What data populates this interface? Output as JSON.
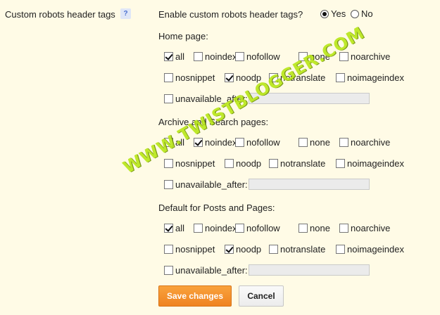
{
  "field_label": "Custom robots header tags",
  "help_glyph": "?",
  "enable": {
    "question": "Enable custom robots header tags?",
    "yes_label": "Yes",
    "no_label": "No",
    "selected": "Yes"
  },
  "sections": [
    {
      "title": "Home page:",
      "row1": [
        {
          "label": "all",
          "checked": true
        },
        {
          "label": "noindex",
          "checked": false
        },
        {
          "label": "nofollow",
          "checked": false
        },
        {
          "label": "none",
          "checked": false
        },
        {
          "label": "noarchive",
          "checked": false
        }
      ],
      "row2": [
        {
          "label": "nosnippet",
          "checked": false
        },
        {
          "label": "noodp",
          "checked": true
        },
        {
          "label": "notranslate",
          "checked": false
        },
        {
          "label": "noimageindex",
          "checked": false
        }
      ],
      "unavailable": {
        "label": "unavailable_after:",
        "checked": false,
        "value": ""
      }
    },
    {
      "title": "Archive and Search pages:",
      "row1": [
        {
          "label": "all",
          "checked": false
        },
        {
          "label": "noindex",
          "checked": true
        },
        {
          "label": "nofollow",
          "checked": false
        },
        {
          "label": "none",
          "checked": false
        },
        {
          "label": "noarchive",
          "checked": false
        }
      ],
      "row2": [
        {
          "label": "nosnippet",
          "checked": false
        },
        {
          "label": "noodp",
          "checked": false
        },
        {
          "label": "notranslate",
          "checked": false
        },
        {
          "label": "noimageindex",
          "checked": false
        }
      ],
      "unavailable": {
        "label": "unavailable_after:",
        "checked": false,
        "value": ""
      }
    },
    {
      "title": "Default for Posts and Pages:",
      "row1": [
        {
          "label": "all",
          "checked": true
        },
        {
          "label": "noindex",
          "checked": false
        },
        {
          "label": "nofollow",
          "checked": false
        },
        {
          "label": "none",
          "checked": false
        },
        {
          "label": "noarchive",
          "checked": false
        }
      ],
      "row2": [
        {
          "label": "nosnippet",
          "checked": false
        },
        {
          "label": "noodp",
          "checked": true
        },
        {
          "label": "notranslate",
          "checked": false
        },
        {
          "label": "noimageindex",
          "checked": false
        }
      ],
      "unavailable": {
        "label": "unavailable_after:",
        "checked": false,
        "value": ""
      }
    }
  ],
  "buttons": {
    "save": "Save changes",
    "cancel": "Cancel"
  },
  "watermark": "WWW.TWISTBLOGGER.COM",
  "colors": {
    "background": "#fffbe6",
    "save_button": "#ef8320",
    "watermark": "#b8e617"
  }
}
